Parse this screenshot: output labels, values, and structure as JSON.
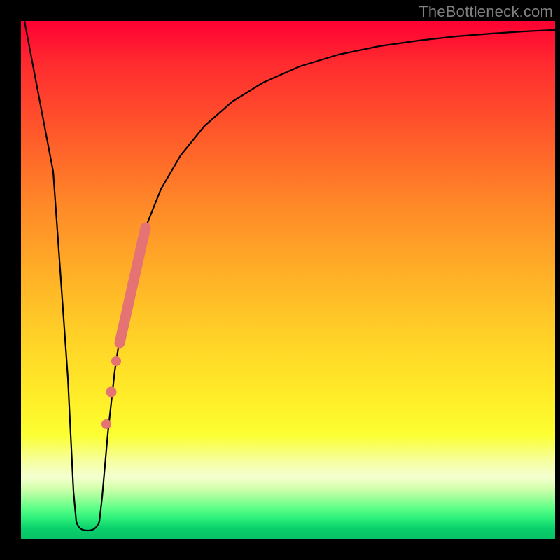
{
  "watermark": "TheBottleneck.com",
  "chart_data": {
    "type": "line",
    "title": "",
    "xlabel": "",
    "ylabel": "",
    "xlim": [
      0,
      100
    ],
    "ylim": [
      0,
      100
    ],
    "grid": false,
    "legend": false,
    "series": [
      {
        "name": "bottleneck-curve",
        "x": [
          0,
          2,
          4,
          6,
          8,
          9,
          10,
          11,
          12,
          13,
          14,
          16,
          18,
          20,
          22,
          25,
          28,
          32,
          36,
          40,
          45,
          50,
          55,
          60,
          65,
          70,
          75,
          80,
          85,
          90,
          95,
          100
        ],
        "y": [
          100,
          80,
          60,
          40,
          20,
          8,
          2,
          1,
          1,
          2,
          8,
          22,
          35,
          46,
          55,
          64,
          71,
          77,
          82,
          85,
          88,
          90.5,
          92,
          93.2,
          94.2,
          95,
          95.7,
          96.2,
          96.6,
          97,
          97.3,
          97.6
        ]
      }
    ],
    "highlight_points": [
      {
        "x": 15.5,
        "y": 18,
        "r": 6
      },
      {
        "x": 16.3,
        "y": 24,
        "r": 6
      },
      {
        "x": 17.2,
        "y": 30,
        "r": 6
      }
    ],
    "highlight_segment": {
      "x_start": 17.8,
      "y_start": 34,
      "x_end": 22.5,
      "y_end": 58
    },
    "colors": {
      "curve": "#000000",
      "highlight": "#e57373",
      "background_top": "#ff0033",
      "background_bottom": "#08c066"
    }
  }
}
